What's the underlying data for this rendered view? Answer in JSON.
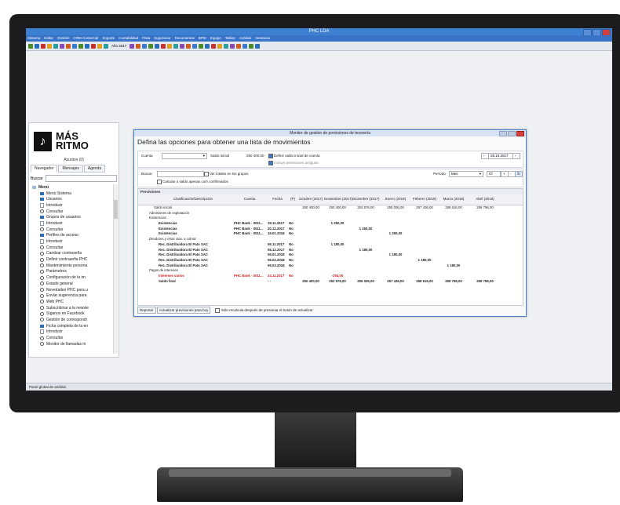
{
  "app": {
    "title": "PHC LDA",
    "menu": [
      "Sistema",
      "Editar",
      "Gestión",
      "CRM Comercial",
      "Soporte",
      "Contabilidad",
      "Flota",
      "Supervisor",
      "Documentos",
      "BPM",
      "Equipo",
      "Tablas",
      "Análisis",
      "Ventanas"
    ],
    "toolbar_year": "Año 2017",
    "statusbar": "Panel global de análisis"
  },
  "left_panel": {
    "logo_line1": "MÁS",
    "logo_line2": "RITMO",
    "asuntos": "Asuntos (0)",
    "tabs": [
      "Navegador",
      "Mensajes",
      "Agenda"
    ],
    "search_label": "Buscar",
    "tree": [
      {
        "icon": "menu",
        "label": "Menú"
      },
      {
        "icon": "folder",
        "label": "Menú Sistema"
      },
      {
        "icon": "folder",
        "label": "Usuarios"
      },
      {
        "icon": "doc",
        "label": "Introducir"
      },
      {
        "icon": "circle",
        "label": "Consultar"
      },
      {
        "icon": "folder",
        "label": "Grupos de usuarios"
      },
      {
        "icon": "doc",
        "label": "Introducir"
      },
      {
        "icon": "circle",
        "label": "Consultar"
      },
      {
        "icon": "folder",
        "label": "Perfiles de acceso"
      },
      {
        "icon": "doc",
        "label": "Introducir"
      },
      {
        "icon": "circle",
        "label": "Consultar"
      },
      {
        "icon": "circle",
        "label": "Cambiar contraseña"
      },
      {
        "icon": "circle",
        "label": "Definir contraseña PHC"
      },
      {
        "icon": "circle",
        "label": "Mantenimiento persona"
      },
      {
        "icon": "circle",
        "label": "Parámetros"
      },
      {
        "icon": "circle",
        "label": "Configuración de la im"
      },
      {
        "icon": "circle",
        "label": "Estado general"
      },
      {
        "icon": "circle",
        "label": "Novedades PHC para u"
      },
      {
        "icon": "circle",
        "label": "Enviar sugerencia para"
      },
      {
        "icon": "circle",
        "label": "Web PHC"
      },
      {
        "icon": "circle",
        "label": "Subscribirse a la newsle"
      },
      {
        "icon": "circle",
        "label": "Síganos en Facebook"
      },
      {
        "icon": "circle",
        "label": "Gestión de correspondi"
      },
      {
        "icon": "folder",
        "label": "Ficha completa de la en"
      },
      {
        "icon": "doc",
        "label": "Introducir"
      },
      {
        "icon": "circle",
        "label": "Consultar"
      },
      {
        "icon": "circle",
        "label": "Monitor de llamadas ni"
      }
    ]
  },
  "dialog": {
    "title": "Monitor de gestión de previsiones de tesorería",
    "heading": "Defina las opciones para obtener una lista de movimientos",
    "cuenta_label": "Cuenta",
    "saldo_inicial_label": "Saldo inicial",
    "saldo_inicial_value": "250 400,00",
    "definir_saldo": "Definir saldo inicial de cuenta",
    "incluye_previsiones": "Incluye previsiones antiguas",
    "date_value": "25.10.2017",
    "buscar_label": "Buscar",
    "ver_totales": "Ver totales en los grupos",
    "calcular_saldo": "Calcular o saldo apenas com confirmados",
    "periodo_label": "Período",
    "periodo_value": "Mes",
    "periodo_num": "07",
    "previsiones_label": "Previsiones",
    "columns": [
      "Clasificación/Descripción",
      "Cuenta",
      "Fecha",
      "(P)",
      "Octubre (2017)",
      "Noviembre (2017)",
      "Diciembre (2017)",
      "Enero (2018)",
      "Febrero (2018)",
      "Marzo (2018)",
      "Abril (2018)"
    ],
    "saldo_inicial_row": [
      "Saldo inicial",
      "",
      "",
      "",
      "250 400,00",
      "250 400,00",
      "252 576,00",
      "255 006,00",
      "257 436,00",
      "258 616,00",
      "259 796,00"
    ],
    "rows": [
      {
        "style": "group",
        "cells": [
          "Admisiones de explotación",
          "",
          "",
          "",
          "",
          "",
          "",
          "",
          "",
          "",
          ""
        ]
      },
      {
        "style": "group",
        "cells": [
          "Existencias",
          "",
          "",
          "",
          "",
          "",
          "",
          "",
          "",
          "",
          ""
        ]
      },
      {
        "style": "bold",
        "cells": [
          "Existencias",
          "PHC Bank · 0011...",
          "19.11.2017",
          "No",
          "",
          "1 250,00",
          "",
          "",
          "",
          "",
          ""
        ]
      },
      {
        "style": "bold",
        "cells": [
          "Existencias",
          "PHC Bank · 0011...",
          "20.12.2017",
          "No",
          "",
          "",
          "1 250,00",
          "",
          "",
          "",
          ""
        ]
      },
      {
        "style": "bold",
        "cells": [
          "Existencias",
          "PHC Bank · 0011...",
          "19.01.2018",
          "No",
          "",
          "",
          "",
          "1 250,00",
          "",
          "",
          ""
        ]
      },
      {
        "style": "group",
        "cells": [
          "Deudores y otras ctas. a cobrar",
          "",
          "",
          "",
          "",
          "",
          "",
          "",
          "",
          "",
          ""
        ]
      },
      {
        "style": "bold",
        "cells": [
          "Rec. Distribuidora El Pato SAC",
          "",
          "06.11.2017",
          "No",
          "",
          "1 180,00",
          "",
          "",
          "",
          "",
          ""
        ]
      },
      {
        "style": "bold",
        "cells": [
          "Rec. Distribuidora El Pato SAC",
          "",
          "06.12.2017",
          "No",
          "",
          "",
          "1 180,00",
          "",
          "",
          "",
          ""
        ]
      },
      {
        "style": "bold",
        "cells": [
          "Rec. Distribuidora El Pato SAC",
          "",
          "06.01.2018",
          "No",
          "",
          "",
          "",
          "1 180,00",
          "",
          "",
          ""
        ]
      },
      {
        "style": "bold",
        "cells": [
          "Rec. Distribuidora El Pato SAC",
          "",
          "06.02.2018",
          "No",
          "",
          "",
          "",
          "",
          "1 180,00",
          "",
          ""
        ]
      },
      {
        "style": "bold",
        "cells": [
          "Rec. Distribuidora El Pato SAC",
          "",
          "06.03.2018",
          "No",
          "",
          "",
          "",
          "",
          "",
          "1 180,00",
          ""
        ]
      },
      {
        "style": "group",
        "cells": [
          "Pagos de intereses",
          "",
          "",
          "",
          "",
          "",
          "",
          "",
          "",
          "",
          ""
        ]
      },
      {
        "style": "red",
        "cells": [
          "Intereses varios",
          "PHC Bank · 0011...",
          "24.11.2017",
          "No",
          "",
          "-254,00",
          "",
          "",
          "",
          "",
          ""
        ]
      },
      {
        "style": "bold",
        "cells": [
          "Saldo final",
          "",
          "- -",
          "",
          "250 400,00",
          "252 576,00",
          "255 006,00",
          "257 436,00",
          "258 616,00",
          "259 796,00",
          "259 796,00"
        ]
      }
    ],
    "reportar_btn": "Reportar",
    "actualizar_btn": "Actualizar previsiones para hoy",
    "solo_recalcula": "Sólo recalcula después de presionar el botón de actualizar"
  }
}
